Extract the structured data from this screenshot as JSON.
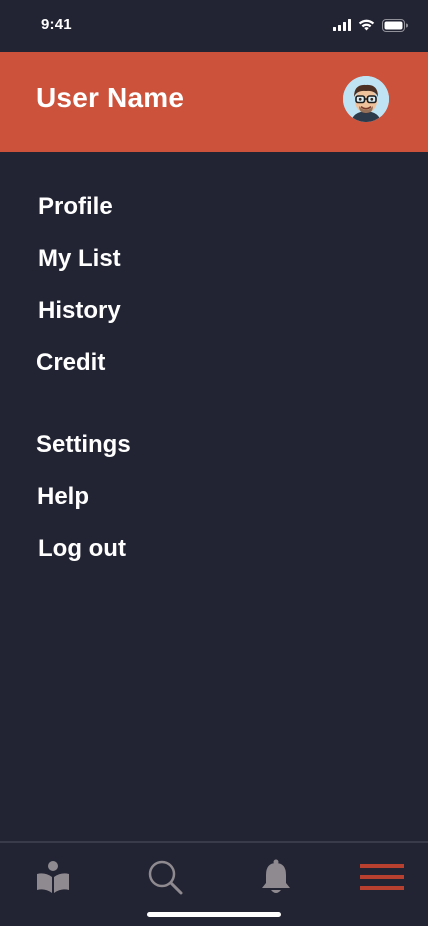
{
  "status_bar": {
    "time": "9:41"
  },
  "header": {
    "user_name": "User Name",
    "avatar_icon": "memoji-avatar"
  },
  "menu": {
    "items": [
      {
        "label": "Profile"
      },
      {
        "label": "My List"
      },
      {
        "label": "History"
      },
      {
        "label": "Credit"
      },
      {
        "label": "Settings"
      },
      {
        "label": "Help"
      },
      {
        "label": "Log out"
      }
    ]
  },
  "tab_bar": {
    "tabs": [
      {
        "icon": "reader-book-icon",
        "active": false
      },
      {
        "icon": "search-icon",
        "active": false
      },
      {
        "icon": "bell-icon",
        "active": false
      },
      {
        "icon": "hamburger-menu-icon",
        "active": true
      }
    ]
  },
  "colors": {
    "background": "#222333",
    "header": "#cc523b",
    "inactive_icon": "#8e8a8f",
    "active_icon": "#b8402e"
  }
}
